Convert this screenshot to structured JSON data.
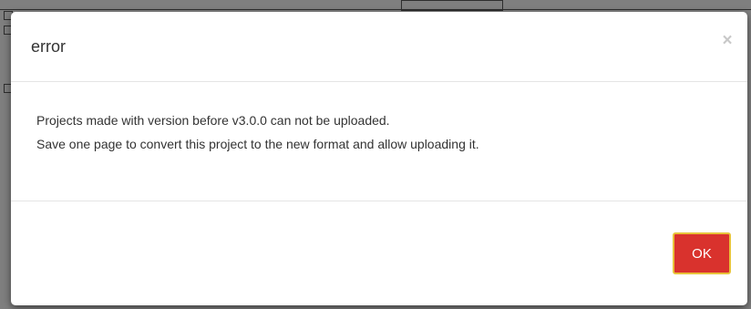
{
  "dialog": {
    "title": "error",
    "close_icon": "close-icon",
    "close_glyph": "×",
    "message_lines": [
      "Projects made with version before v3.0.0 can not be uploaded.",
      "Save one page to convert this project to the new format and allow uploading it."
    ],
    "ok_label": "OK"
  },
  "colors": {
    "backdrop": "#7f7f7f",
    "ok_button": "#d9322d",
    "ok_button_focus_border": "#e8c23a",
    "text": "#333333",
    "close_icon": "#c8c8c8"
  }
}
